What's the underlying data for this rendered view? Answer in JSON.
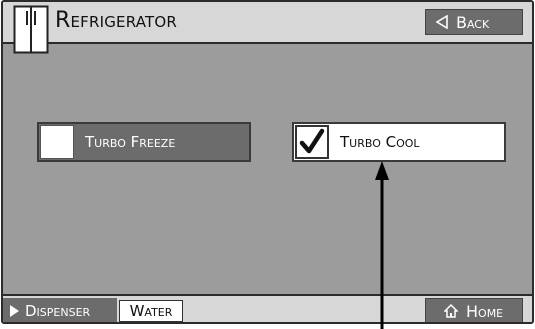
{
  "header": {
    "title": "Refrigerator",
    "back_label": "Back",
    "icon": "refrigerator-icon"
  },
  "options": [
    {
      "label": "Turbo Freeze",
      "checked": false
    },
    {
      "label": "Turbo Cool",
      "checked": true
    }
  ],
  "bottom_bar": {
    "dispenser_label": "Dispenser",
    "water_label": "Water",
    "home_label": "Home"
  },
  "colors": {
    "panel_bg": "#9c9c9c",
    "bar_bg": "#d7d7d7",
    "button_dark": "#6c6c6c"
  }
}
